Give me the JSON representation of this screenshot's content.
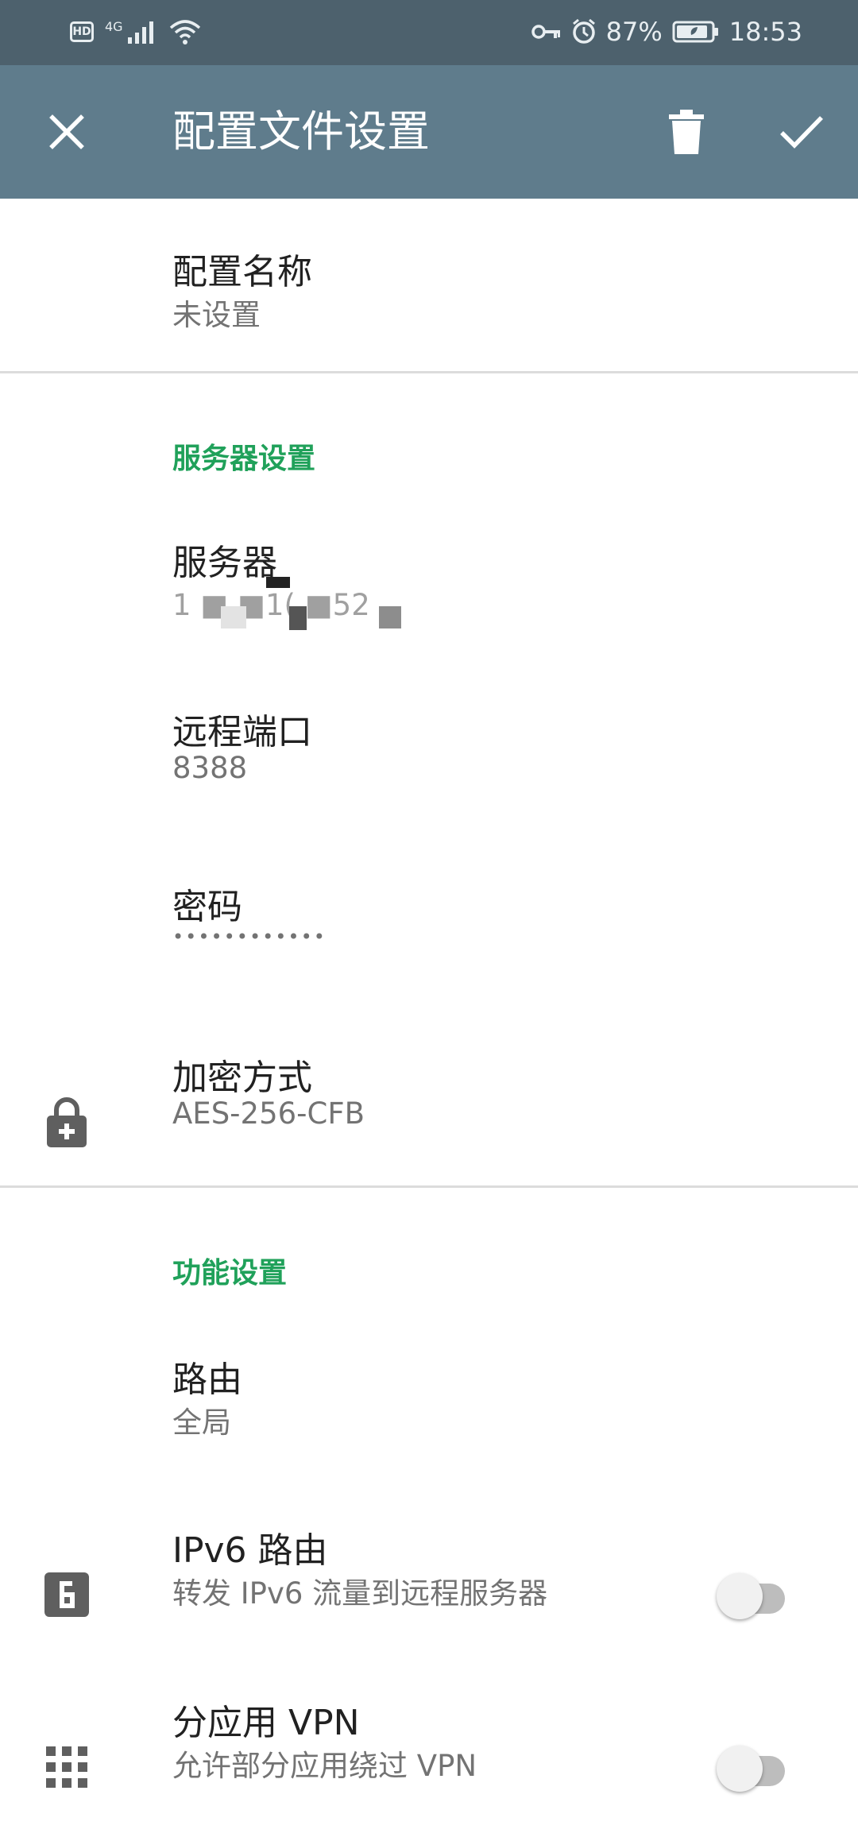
{
  "status_bar": {
    "network": "4G",
    "hd": "HD",
    "battery": "87%",
    "time": "18:53"
  },
  "toolbar": {
    "title": "配置文件设置"
  },
  "profile": {
    "name_label": "配置名称",
    "name_value": "未设置"
  },
  "server_section": {
    "header": "服务器设置",
    "server_label": "服务器",
    "server_value": "1  ■  ■1(  ■52",
    "port_label": "远程端口",
    "port_value": "8388",
    "password_label": "密码",
    "password_value": "••••••••••••",
    "encryption_label": "加密方式",
    "encryption_value": "AES-256-CFB"
  },
  "feature_section": {
    "header": "功能设置",
    "route_label": "路由",
    "route_value": "全局",
    "ipv6_label": "IPv6 路由",
    "ipv6_desc": "转发 IPv6 流量到远程服务器",
    "ipv6_enabled": false,
    "per_app_label": "分应用 VPN",
    "per_app_desc": "允许部分应用绕过 VPN",
    "per_app_enabled": false
  },
  "colors": {
    "status_bar": "#4d616d",
    "toolbar": "#5f7c8c",
    "accent": "#20a15a",
    "title_text": "#212121",
    "secondary_text": "#737373"
  }
}
